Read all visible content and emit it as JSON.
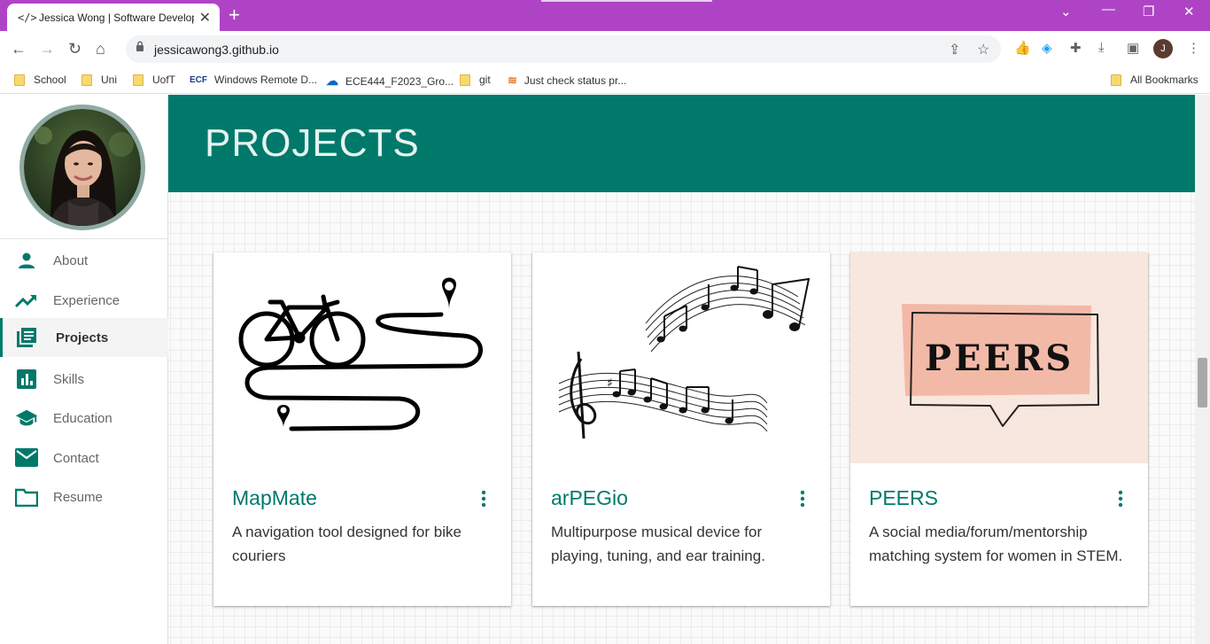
{
  "browser": {
    "tab_title": "Jessica Wong | Software Developer",
    "tab_favicon": "</>",
    "new_tab": "+",
    "url": "jessicawong3.github.io",
    "profile_initial": "J",
    "bookmarks": [
      {
        "label": "School",
        "icon": "folder-icon"
      },
      {
        "label": "Uni",
        "icon": "folder-icon"
      },
      {
        "label": "UofT",
        "icon": "folder-icon"
      },
      {
        "label": "Windows Remote D...",
        "icon": "ecf-icon",
        "badge": "ECF"
      },
      {
        "label": "ECE444_F2023_Gro...",
        "icon": "onedrive-icon"
      },
      {
        "label": "git",
        "icon": "folder-icon"
      },
      {
        "label": "Just check status pr...",
        "icon": "stackoverflow-icon"
      }
    ],
    "all_bookmarks": "All Bookmarks"
  },
  "sidebar": {
    "items": [
      {
        "label": "About",
        "icon": "person-icon"
      },
      {
        "label": "Experience",
        "icon": "trending-up-icon"
      },
      {
        "label": "Projects",
        "icon": "library-books-icon",
        "active": true
      },
      {
        "label": "Skills",
        "icon": "bar-chart-icon"
      },
      {
        "label": "Education",
        "icon": "school-icon"
      },
      {
        "label": "Contact",
        "icon": "mail-icon"
      },
      {
        "label": "Resume",
        "icon": "folder-icon"
      }
    ]
  },
  "main": {
    "title": "PROJECTS",
    "projects": [
      {
        "title": "MapMate",
        "description": "A navigation tool designed for bike couriers",
        "image": "bike-route-illustration"
      },
      {
        "title": "arPEGio",
        "description": "Multipurpose musical device for playing, tuning, and ear training.",
        "image": "music-staff-illustration"
      },
      {
        "title": "PEERS",
        "description": "A social media/forum/mentorship matching system for women in STEM.",
        "image": "peers-logo",
        "logo_text": "PEERS"
      }
    ]
  },
  "colors": {
    "accent": "#00796b",
    "tabbar": "#ae44c5"
  }
}
